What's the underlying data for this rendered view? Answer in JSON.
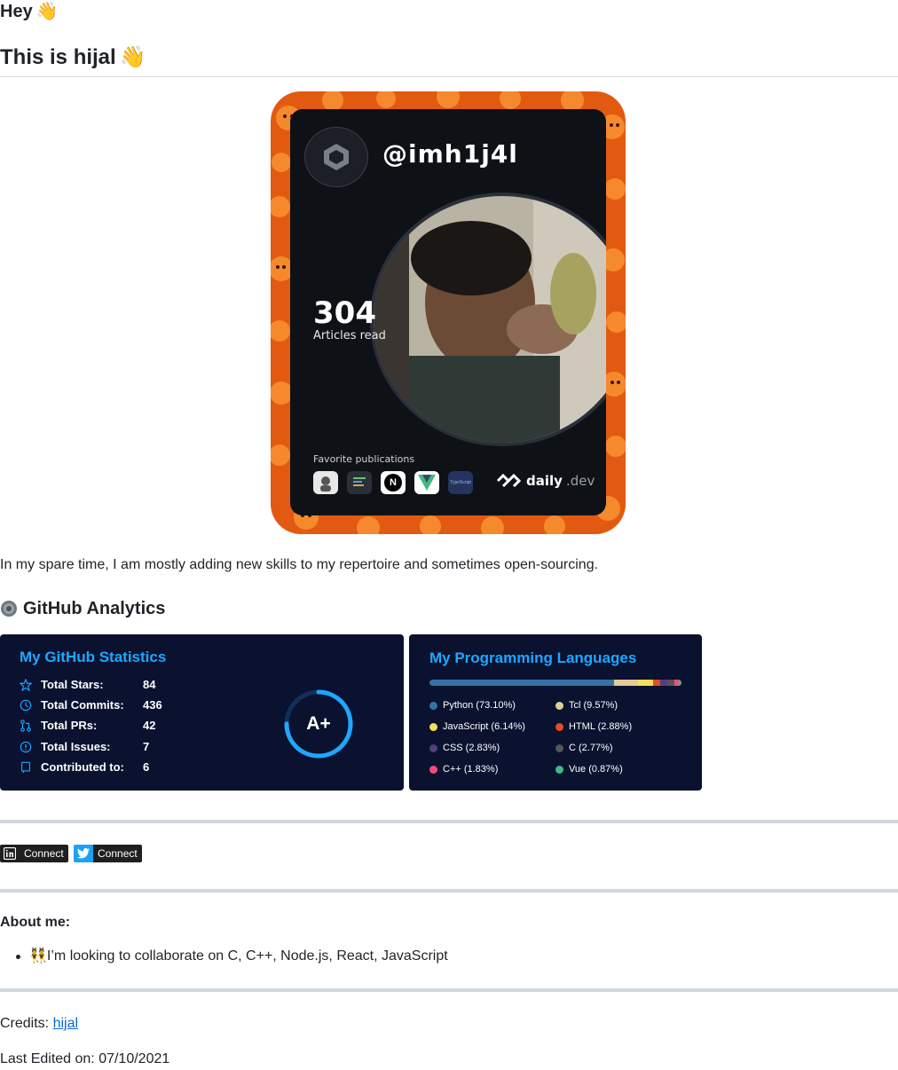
{
  "header": {
    "greeting": "Hey",
    "wave_emoji": "👋",
    "title": "This is hijal",
    "title_emoji": "👋"
  },
  "devcard": {
    "handle": "@imh1j4l",
    "articles_count": "304",
    "articles_label": "Articles read",
    "favorite_label": "Favorite publications",
    "publications": [
      "avatar-publication",
      "code-publication",
      "N",
      "V",
      "TypeScript"
    ],
    "brand_name": "daily",
    "brand_suffix": ".dev",
    "colors": {
      "frame": "#e25a12",
      "card": "#0e1217"
    }
  },
  "intro": {
    "text": "In my spare time, I am mostly adding new skills to my repertoire and sometimes open-sourcing."
  },
  "analytics": {
    "heading": "GitHub Analytics",
    "heading_icon": "gear-icon"
  },
  "github_stats": {
    "title": "My GitHub Statistics",
    "rows": [
      {
        "label": "Total Stars:",
        "value": "84",
        "icon": "star-icon"
      },
      {
        "label": "Total Commits:",
        "value": "436",
        "icon": "clock-icon"
      },
      {
        "label": "Total PRs:",
        "value": "42",
        "icon": "pull-request-icon"
      },
      {
        "label": "Total Issues:",
        "value": "7",
        "icon": "issue-icon"
      },
      {
        "label": "Contributed to:",
        "value": "6",
        "icon": "repo-icon"
      }
    ],
    "rank": "A+",
    "rank_progress": 0.75,
    "colors": {
      "title": "#1ea7ff",
      "background": "#0a1230",
      "ring": "#1ea7ff"
    }
  },
  "languages": {
    "title": "My Programming Languages",
    "items": [
      {
        "name": "Python (73.10%)",
        "percent": 73.1,
        "color": "#3572A5"
      },
      {
        "name": "Tcl (9.57%)",
        "percent": 9.57,
        "color": "#e4cc98"
      },
      {
        "name": "JavaScript (6.14%)",
        "percent": 6.14,
        "color": "#f1e05a"
      },
      {
        "name": "HTML (2.88%)",
        "percent": 2.88,
        "color": "#e34c26"
      },
      {
        "name": "CSS (2.83%)",
        "percent": 2.83,
        "color": "#563d7c"
      },
      {
        "name": "C (2.77%)",
        "percent": 2.77,
        "color": "#555555"
      },
      {
        "name": "C++ (1.83%)",
        "percent": 1.83,
        "color": "#f34b7d"
      },
      {
        "name": "Vue (0.87%)",
        "percent": 0.87,
        "color": "#41b883"
      }
    ]
  },
  "social": {
    "linkedin_label": "Connect",
    "twitter_label": "Connect",
    "colors": {
      "linkedin": "#0a66c2",
      "twitter": "#1da1f2"
    }
  },
  "about": {
    "heading": "About me:",
    "emoji": "👯",
    "item": "I’m looking to collaborate on C, C++, Node.js, React, JavaScript"
  },
  "footer": {
    "credits_label": "Credits:",
    "credits_link": "hijal",
    "last_edited": "Last Edited on: 07/10/2021"
  }
}
